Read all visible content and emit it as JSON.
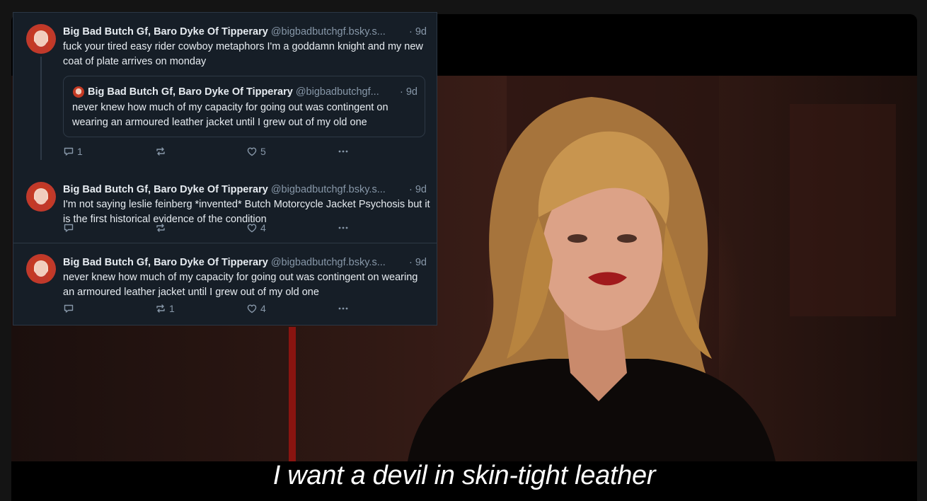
{
  "subtitle": "I want a devil in skin-tight leather",
  "posts": [
    {
      "author": "Big Bad Butch Gf, Baro Dyke Of Tipperary",
      "handle": "@bigbadbutchgf.bsky.s...",
      "time": "· 9d",
      "text": "fuck your tired easy rider cowboy metaphors I'm a goddamn knight and my new coat of plate arrives on monday",
      "quote": {
        "author": "Big Bad Butch Gf, Baro Dyke Of Tipperary",
        "handle": "@bigbadbutchgf...",
        "time": "· 9d",
        "text": "never knew how much of my capacity for going out was contingent on wearing an armoured leather jacket until I grew out of my old one"
      },
      "replies": "1",
      "reposts": "",
      "likes": "5"
    },
    {
      "author": "Big Bad Butch Gf, Baro Dyke Of Tipperary",
      "handle": "@bigbadbutchgf.bsky.s...",
      "time": "· 9d",
      "text": "I'm not saying leslie feinberg *invented* Butch Motorcycle Jacket Psychosis but it is the first historical evidence of the condition",
      "replies": "",
      "reposts": "",
      "likes": "4"
    },
    {
      "author": "Big Bad Butch Gf, Baro Dyke Of Tipperary",
      "handle": "@bigbadbutchgf.bsky.s...",
      "time": "· 9d",
      "text": "never knew how much of my capacity for going out was contingent on wearing an armoured leather jacket until I grew out of my old one",
      "replies": "",
      "reposts": "1",
      "likes": "4"
    }
  ],
  "icons": {
    "reply": "reply-icon",
    "repost": "repost-icon",
    "like": "heart-icon",
    "more": "more-icon"
  },
  "colors": {
    "panel_bg": "#161e27",
    "text_primary": "#e7ecf1",
    "text_secondary": "#8797a8",
    "subtitle": "#ffffff"
  }
}
